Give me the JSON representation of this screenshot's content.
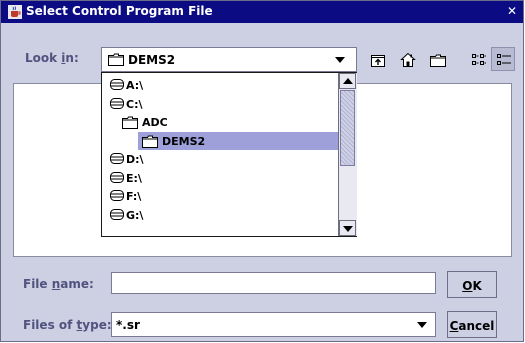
{
  "window": {
    "title": "Select Control Program File",
    "close_glyph": "✕"
  },
  "look_in": {
    "label_pre": "Look ",
    "label_mnemonic": "i",
    "label_post": "n:",
    "selected": "DEMS2"
  },
  "toolbar": {
    "icons": [
      "up-one-level-icon",
      "home-icon",
      "new-folder-icon",
      "list-view-icon",
      "details-view-icon"
    ]
  },
  "dropdown": {
    "items": [
      {
        "label": "A:\\",
        "icon": "drive-icon",
        "indent": 0,
        "selected": false
      },
      {
        "label": "C:\\",
        "icon": "drive-icon",
        "indent": 0,
        "selected": false
      },
      {
        "label": "ADC",
        "icon": "folder-icon",
        "indent": 1,
        "selected": false
      },
      {
        "label": "DEMS2",
        "icon": "folder-icon",
        "indent": 2,
        "selected": true
      },
      {
        "label": "D:\\",
        "icon": "drive-icon",
        "indent": 0,
        "selected": false
      },
      {
        "label": "E:\\",
        "icon": "drive-icon",
        "indent": 0,
        "selected": false
      },
      {
        "label": "F:\\",
        "icon": "drive-icon",
        "indent": 0,
        "selected": false
      },
      {
        "label": "G:\\",
        "icon": "drive-icon",
        "indent": 0,
        "selected": false
      }
    ]
  },
  "file_name": {
    "label_pre": "File ",
    "label_mnemonic": "n",
    "label_post": "ame:",
    "value": ""
  },
  "files_of_type": {
    "label_pre": "Files of ",
    "label_mnemonic": "t",
    "label_post": "ype:",
    "selected": "*.sr"
  },
  "buttons": {
    "ok_mnemonic": "O",
    "ok_rest": "K",
    "cancel_mnemonic": "C",
    "cancel_rest": "ancel"
  },
  "colors": {
    "titlebar": "#0b0c84",
    "dialog_bg": "#cdd0e3",
    "selection": "#9ea0da",
    "label_text": "#50537e"
  }
}
